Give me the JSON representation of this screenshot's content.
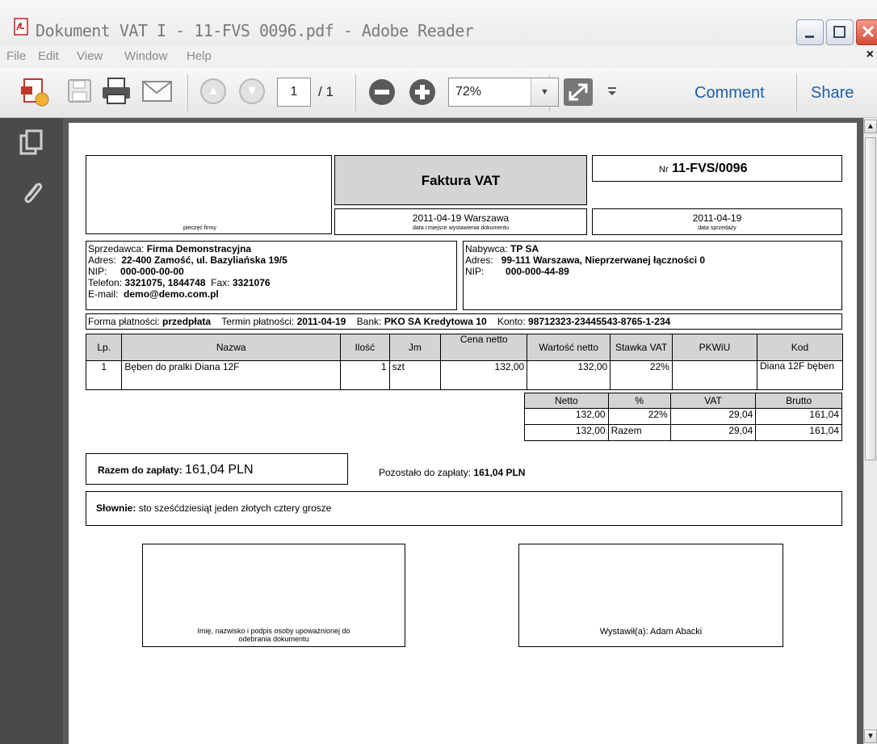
{
  "window": {
    "title": "Dokument VAT I - 11-FVS 0096.pdf - Adobe Reader"
  },
  "menu": {
    "items": [
      "File",
      "Edit",
      "View",
      "Window",
      "Help"
    ],
    "close_glyph": "×"
  },
  "toolbar": {
    "page_current": "1",
    "page_total": "/ 1",
    "zoom": "72%",
    "comment_label": "Comment",
    "share_label": "Share"
  },
  "invoice": {
    "title": "Faktura VAT",
    "number_prefix": "Nr",
    "number": "11-FVS/0096",
    "stamp_label": "pieczęć firmy",
    "issue_date_place": "2011-04-19  Warszawa",
    "issue_date_caption": "data i miejsce wystawienia dokumentu",
    "sale_date": "2011-04-19",
    "sale_date_caption": "data sprzedaży",
    "seller": {
      "label": "Sprzedawca:",
      "name": "Firma Demonstracyjna",
      "address_label": "Adres:",
      "address": "22-400 Zamość, ul. Bazyliańska 19/5",
      "nip_label": "NIP:",
      "nip": "000-000-00-00",
      "phone_label": "Telefon:",
      "phone": "3321075, 1844748",
      "fax_label": "Fax:",
      "fax": "3321076",
      "email_label": "E-mail:",
      "email": "demo@demo.com.pl"
    },
    "buyer": {
      "label": "Nabywca:",
      "name": "TP SA",
      "address_label": "Adres:",
      "address": "99-111 Warszawa, Nieprzerwanej łączności 0",
      "nip_label": "NIP:",
      "nip": "000-000-44-89"
    },
    "payment": {
      "form_label": "Forma płatności:",
      "form": "przedpłata",
      "due_label": "Termin płatności:",
      "due": "2011-04-19",
      "bank_label": "Bank:",
      "bank": "PKO SA Kredytowa 10",
      "account_label": "Konto:",
      "account": "98712323-23445543-8765-1-234"
    },
    "items_headers": [
      "Lp.",
      "Nazwa",
      "Ilość",
      "Jm",
      "Cena netto",
      "Wartość netto",
      "Stawka VAT",
      "PKWiU",
      "Kod"
    ],
    "items": [
      {
        "lp": "1",
        "nazwa": "Bęben do pralki Diana 12F",
        "ilosc": "1",
        "jm": "szt",
        "cena": "132,00",
        "wartosc": "132,00",
        "stawka": "22%",
        "pkwiu": "",
        "kod": "Diana 12F bęben"
      }
    ],
    "summary_headers": [
      "Netto",
      "%",
      "VAT",
      "Brutto"
    ],
    "summary_rows": [
      {
        "netto": "132,00",
        "pct": "22%",
        "vat": "29,04",
        "brutto": "161,04"
      },
      {
        "netto": "132,00",
        "pct": "Razem",
        "vat": "29,04",
        "brutto": "161,04"
      }
    ],
    "total_label": "Razem do zapłaty:",
    "total_value": "161,04 PLN",
    "remaining_label": "Pozostało do zapłaty:",
    "remaining_value": "161,04 PLN",
    "words_label": "Słownie:",
    "words_value": "sto sześćdziesiąt jeden złotych cztery grosze",
    "sign_receiver": "Imię, nazwisko i podpis osoby upoważnionej do odebrania dokumentu",
    "sign_issuer": "Wystawił(a): Adam Abacki"
  }
}
